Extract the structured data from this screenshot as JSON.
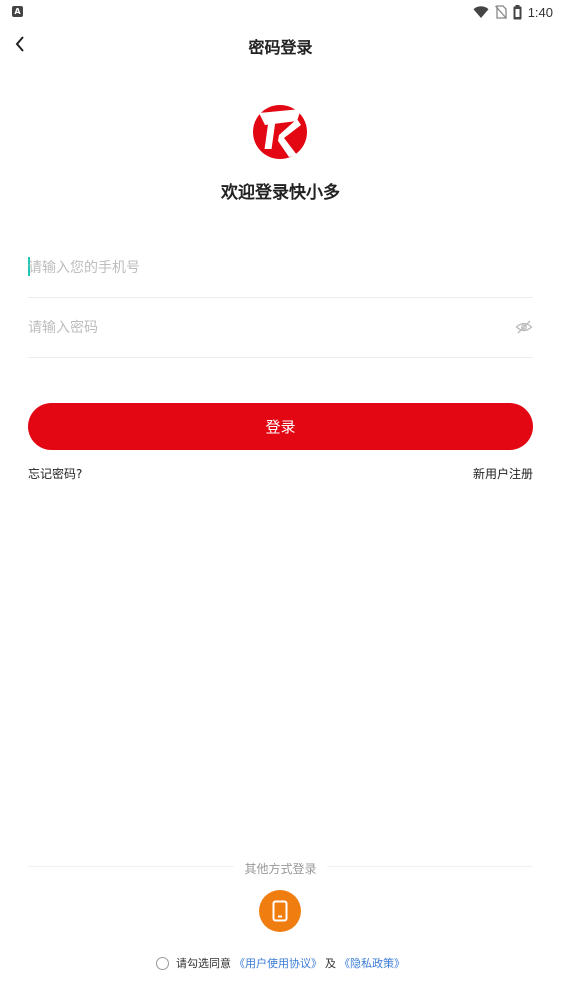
{
  "status_bar": {
    "left_icon": "A",
    "time": "1:40",
    "icons": [
      "wifi-icon",
      "no-sim-icon",
      "battery-icon"
    ]
  },
  "nav": {
    "title": "密码登录"
  },
  "brand": {
    "welcome": "欢迎登录快小多",
    "logo_color": "#e30613"
  },
  "form": {
    "phone_placeholder": "请输入您的手机号",
    "phone_value": "",
    "password_placeholder": "请输入密码",
    "password_value": "",
    "login_label": "登录",
    "forgot_label": "忘记密码?",
    "register_label": "新用户注册"
  },
  "other_login": {
    "label": "其他方式登录",
    "method_icon": "phone-icon",
    "method_color": "#f07d0f"
  },
  "agreement": {
    "prefix": "请勾选同意",
    "user_agreement": "《用户使用协议》",
    "and": "及",
    "privacy_policy": "《隐私政策》",
    "link_color": "#3a7bd5"
  },
  "colors": {
    "accent": "#e30613",
    "caret": "#1ec8b4"
  }
}
